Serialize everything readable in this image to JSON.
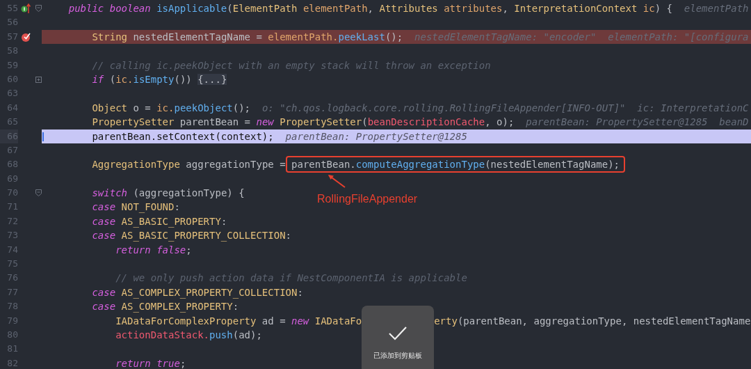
{
  "editor": {
    "lines": [
      {
        "number": "55",
        "overridden": true,
        "fold_start": true,
        "tokens": [
          {
            "text": "    public boolean",
            "kind": "keyword"
          },
          {
            "text": " isApplicable",
            "kind": "method"
          },
          {
            "text": "(",
            "kind": "plain"
          },
          {
            "text": "ElementPath",
            "kind": "type"
          },
          {
            "text": " elementPath",
            "kind": "param"
          },
          {
            "text": ", ",
            "kind": "plain"
          },
          {
            "text": "Attributes",
            "kind": "type"
          },
          {
            "text": " attributes",
            "kind": "param"
          },
          {
            "text": ", ",
            "kind": "plain"
          },
          {
            "text": "InterpretationContext",
            "kind": "type"
          },
          {
            "text": " ic",
            "kind": "param"
          },
          {
            "text": ") {",
            "kind": "plain"
          },
          {
            "text": "  elementPath",
            "kind": "hint"
          }
        ]
      },
      {
        "number": "56"
      },
      {
        "number": "57",
        "breakpoint": true,
        "tokens": [
          {
            "text": "        String",
            "kind": "type"
          },
          {
            "text": " nestedElementTagName = ",
            "kind": "plain"
          },
          {
            "text": "elementPath.",
            "kind": "param"
          },
          {
            "text": "peekLast",
            "kind": "method"
          },
          {
            "text": "();",
            "kind": "plain"
          },
          {
            "text": "  nestedElementTagName: \"encoder\"  elementPath: \"[configura",
            "kind": "hint"
          }
        ]
      },
      {
        "number": "58"
      },
      {
        "number": "59",
        "tokens": [
          {
            "text": "        // calling ic.peekObject with an empty stack will throw an exception",
            "kind": "comment"
          }
        ]
      },
      {
        "number": "60",
        "collapsed": true,
        "tokens": [
          {
            "text": "        if",
            "kind": "keyword"
          },
          {
            "text": " (",
            "kind": "plain"
          },
          {
            "text": "ic.",
            "kind": "param"
          },
          {
            "text": "isEmpty",
            "kind": "method"
          },
          {
            "text": "()) ",
            "kind": "plain"
          },
          {
            "text": "{...}",
            "kind": "folded"
          }
        ]
      },
      {
        "number": "63"
      },
      {
        "number": "64",
        "tokens": [
          {
            "text": "        Object",
            "kind": "type"
          },
          {
            "text": " o = ",
            "kind": "plain"
          },
          {
            "text": "ic.",
            "kind": "param"
          },
          {
            "text": "peekObject",
            "kind": "method"
          },
          {
            "text": "();",
            "kind": "plain"
          },
          {
            "text": "  o: \"ch.qos.logback.core.rolling.RollingFileAppender[INFO-OUT]\"  ic: InterpretationC",
            "kind": "hint"
          }
        ]
      },
      {
        "number": "65",
        "tokens": [
          {
            "text": "        PropertySetter",
            "kind": "type"
          },
          {
            "text": " parentBean = ",
            "kind": "plain"
          },
          {
            "text": "new",
            "kind": "keyword"
          },
          {
            "text": " PropertySetter",
            "kind": "type"
          },
          {
            "text": "(",
            "kind": "plain"
          },
          {
            "text": "beanDescriptionCache",
            "kind": "field"
          },
          {
            "text": ", o);",
            "kind": "plain"
          },
          {
            "text": "  parentBean: PropertySetter@1285  beanD",
            "kind": "hint"
          }
        ]
      },
      {
        "number": "66",
        "current": true,
        "tokens": [
          {
            "text": "        parentBean.setContext(context);",
            "kind": "plain"
          },
          {
            "text": "  parentBean: PropertySetter@1285",
            "kind": "hint"
          }
        ]
      },
      {
        "number": "67"
      },
      {
        "number": "68",
        "tokens": [
          {
            "text": "        AggregationType",
            "kind": "type"
          },
          {
            "text": " aggregationType = ",
            "kind": "plain"
          },
          {
            "kind": "annotation",
            "note": "RollingFileAppender",
            "tokens": [
              {
                "text": "parentBean.",
                "kind": "plain"
              },
              {
                "text": "computeAggregationType",
                "kind": "method"
              },
              {
                "text": "(nestedElementTagName);",
                "kind": "plain"
              }
            ]
          }
        ]
      },
      {
        "number": "69"
      },
      {
        "number": "70",
        "fold_start": true,
        "tokens": [
          {
            "text": "        switch",
            "kind": "keyword"
          },
          {
            "text": " (aggregationType) {",
            "kind": "plain"
          }
        ]
      },
      {
        "number": "71",
        "tokens": [
          {
            "text": "        case",
            "kind": "keyword"
          },
          {
            "text": " NOT_FOUND",
            "kind": "type"
          },
          {
            "text": ":",
            "kind": "plain"
          }
        ]
      },
      {
        "number": "72",
        "tokens": [
          {
            "text": "        case",
            "kind": "keyword"
          },
          {
            "text": " AS_BASIC_PROPERTY",
            "kind": "type"
          },
          {
            "text": ":",
            "kind": "plain"
          }
        ]
      },
      {
        "number": "73",
        "tokens": [
          {
            "text": "        case",
            "kind": "keyword"
          },
          {
            "text": " AS_BASIC_PROPERTY_COLLECTION",
            "kind": "type"
          },
          {
            "text": ":",
            "kind": "plain"
          }
        ]
      },
      {
        "number": "74",
        "tokens": [
          {
            "text": "            return false",
            "kind": "keyword"
          },
          {
            "text": ";",
            "kind": "plain"
          }
        ]
      },
      {
        "number": "75"
      },
      {
        "number": "76",
        "tokens": [
          {
            "text": "            // we only push action data if NestComponentIA is applicable",
            "kind": "comment"
          }
        ]
      },
      {
        "number": "77",
        "tokens": [
          {
            "text": "        case",
            "kind": "keyword"
          },
          {
            "text": " AS_COMPLEX_PROPERTY_COLLECTION",
            "kind": "type"
          },
          {
            "text": ":",
            "kind": "plain"
          }
        ]
      },
      {
        "number": "78",
        "tokens": [
          {
            "text": "        case",
            "kind": "keyword"
          },
          {
            "text": " AS_COMPLEX_PROPERTY",
            "kind": "type"
          },
          {
            "text": ":",
            "kind": "plain"
          }
        ]
      },
      {
        "number": "79",
        "tokens": [
          {
            "text": "            IADataForComplexProperty",
            "kind": "type"
          },
          {
            "text": " ad = ",
            "kind": "plain"
          },
          {
            "text": "new",
            "kind": "keyword"
          },
          {
            "text": " IADataFo",
            "kind": "type"
          },
          {
            "kind": "toast"
          },
          {
            "text": "erty",
            "kind": "type"
          },
          {
            "text": "(parentBean, aggregationType, nestedElementTagName",
            "kind": "plain"
          }
        ]
      },
      {
        "number": "80",
        "tokens": [
          {
            "text": "            actionDataStack.",
            "kind": "field"
          },
          {
            "text": "push",
            "kind": "method"
          },
          {
            "text": "(ad);",
            "kind": "plain"
          }
        ]
      },
      {
        "number": "81"
      },
      {
        "number": "82",
        "tokens": [
          {
            "text": "            return true",
            "kind": "keyword"
          },
          {
            "text": ";",
            "kind": "plain"
          }
        ]
      }
    ]
  },
  "toast": {
    "message": "已添加到剪贴板"
  }
}
